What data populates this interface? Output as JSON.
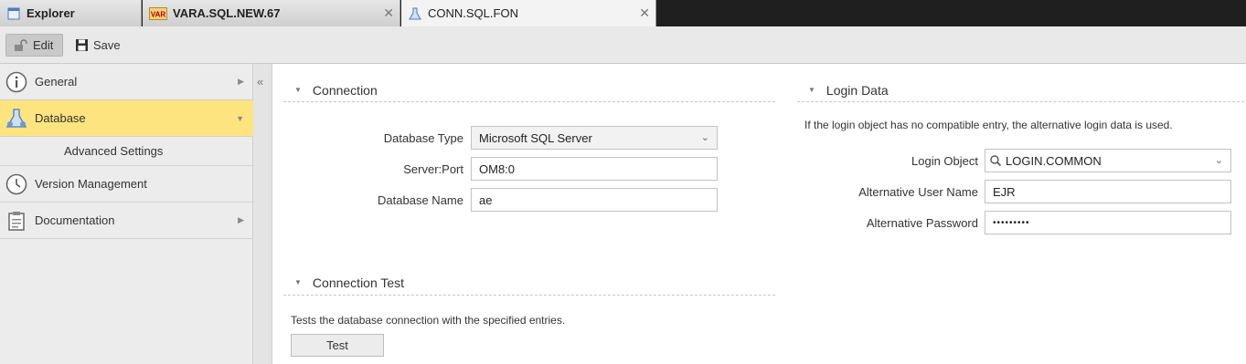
{
  "tabs": [
    {
      "label": "Explorer",
      "icon": "explorer-icon"
    },
    {
      "label": "VARA.SQL.NEW.67",
      "icon": "var-icon",
      "icon_text": "VAR"
    },
    {
      "label": "CONN.SQL.FON",
      "icon": "connection-icon",
      "active": true
    }
  ],
  "toolbar": {
    "edit_label": "Edit",
    "save_label": "Save"
  },
  "sidebar": {
    "items": [
      {
        "label": "General",
        "icon": "info-icon"
      },
      {
        "label": "Database",
        "icon": "database-icon",
        "selected": true
      },
      {
        "label": "Version Management",
        "icon": "clock-icon"
      },
      {
        "label": "Documentation",
        "icon": "clipboard-icon"
      }
    ],
    "sub_items": [
      {
        "label": "Advanced Settings"
      }
    ],
    "collapse_glyph": "«"
  },
  "connection": {
    "title": "Connection",
    "db_type_label": "Database Type",
    "db_type_value": "Microsoft SQL Server",
    "server_port_label": "Server:Port",
    "server_port_value": "OM8:0",
    "db_name_label": "Database Name",
    "db_name_value": "ae"
  },
  "connection_test": {
    "title": "Connection Test",
    "description": "Tests the database connection with the specified entries.",
    "button_label": "Test"
  },
  "login_data": {
    "title": "Login Data",
    "description": "If the login object has no compatible entry, the alternative login data is used.",
    "login_object_label": "Login Object",
    "login_object_value": "LOGIN.COMMON",
    "alt_user_label": "Alternative User Name",
    "alt_user_value": "EJR",
    "alt_password_label": "Alternative Password",
    "alt_password_value": "•••••••••"
  },
  "colors": {
    "selected_bg": "#fde47f",
    "tabbar_bg": "#1f1f1f"
  }
}
